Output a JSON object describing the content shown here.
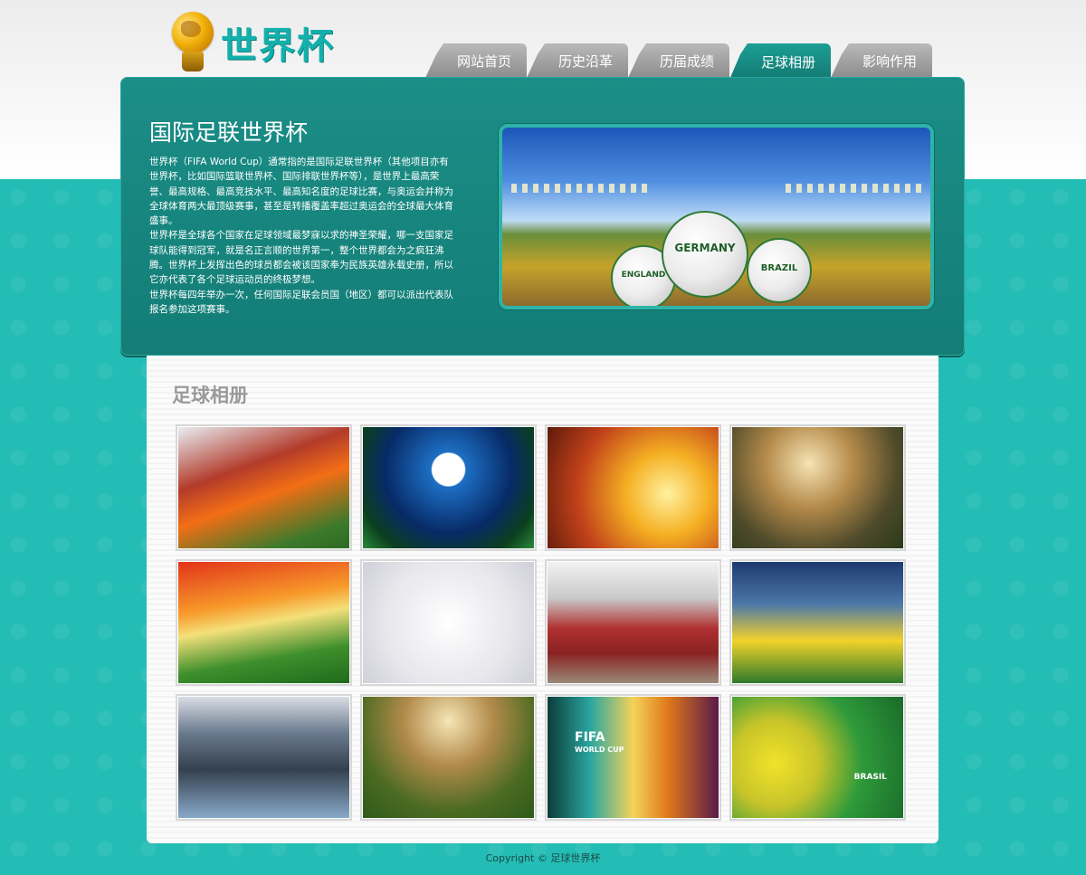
{
  "logo": {
    "text": "世界杯"
  },
  "nav": {
    "tabs": [
      {
        "label": "网站首页",
        "active": false
      },
      {
        "label": "历史沿革",
        "active": false
      },
      {
        "label": "历届成绩",
        "active": false
      },
      {
        "label": "足球相册",
        "active": true
      },
      {
        "label": "影响作用",
        "active": false
      }
    ]
  },
  "hero": {
    "title": "国际足联世界杯",
    "paragraphs": [
      "世界杯（FIFA World Cup）通常指的是国际足联世界杯（其他项目亦有世界杯，比如国际篮联世界杯、国际排联世界杯等），是世界上最高荣誉、最高规格、最高竞技水平、最高知名度的足球比赛，与奥运会并称为全球体育两大最顶级赛事，甚至是转播覆盖率超过奥运会的全球最大体育盛事。",
      "世界杯是全球各个国家在足球领域最梦寐以求的神圣荣耀，哪一支国家足球队能得到冠军，就是名正言顺的世界第一，整个世界都会为之疯狂沸腾。世界杯上发挥出色的球员都会被该国家奉为民族英雄永载史册，所以它亦代表了各个足球运动员的终极梦想。",
      "世界杯每四年举办一次，任何国际足联会员国（地区）都可以派出代表队报名参加这项赛事。"
    ],
    "image_balls": [
      "ENGLAND",
      "GERMANY",
      "BRAZIL"
    ]
  },
  "gallery": {
    "title": "足球相册",
    "photos": [
      {
        "subject": "match-players"
      },
      {
        "subject": "splash-ball"
      },
      {
        "subject": "trophy-silhouette"
      },
      {
        "subject": "bicycle-kick"
      },
      {
        "subject": "celebration-knee"
      },
      {
        "subject": "balls-on-white"
      },
      {
        "subject": "player-red-shirt"
      },
      {
        "subject": "team-celebration"
      },
      {
        "subject": "fans-trophy"
      },
      {
        "subject": "player-in-grass"
      },
      {
        "subject": "fifa-world-cup-poster"
      },
      {
        "subject": "brasil-flag-ball"
      }
    ],
    "poster_text": [
      "FIFA",
      "WORLD CUP"
    ],
    "flag_text": "BRASIL"
  },
  "footer": {
    "text": "Copyright © 足球世界杯"
  }
}
